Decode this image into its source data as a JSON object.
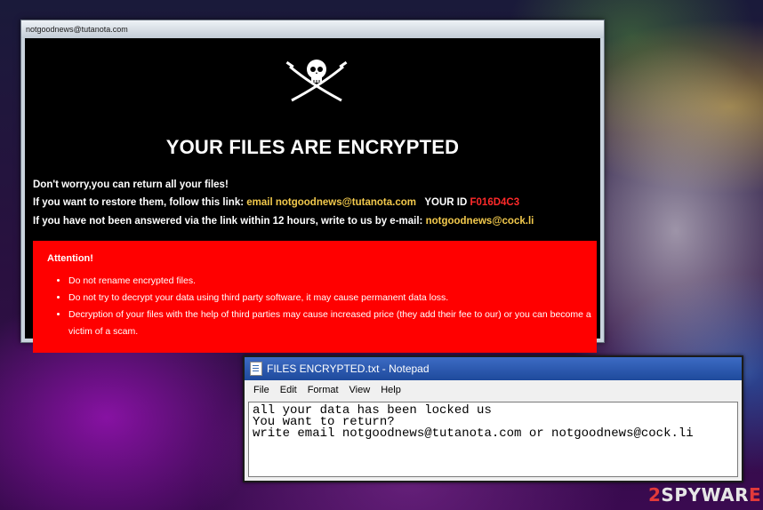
{
  "ransom_window": {
    "title": "notgoodnews@tutanota.com",
    "headline": "YOUR FILES ARE ENCRYPTED",
    "line1": "Don't worry,you can return all your files!",
    "line2_prefix": "If you want to restore them, follow this link:",
    "line2_link": "email notgoodnews@tutanota.com",
    "line2_id_label": "YOUR ID",
    "line2_id_value": "F016D4C3",
    "line3_prefix": "If you have not been answered via the link within 12 hours, write to us by e-mail:",
    "line3_email": "notgoodnews@cock.li",
    "attention": {
      "title": "Attention!",
      "items": [
        "Do not rename encrypted files.",
        "Do not try to decrypt your data using third party software, it may cause permanent data loss.",
        "Decryption of your files with the help of third parties may cause increased price (they add their fee to our) or you can become a victim of a scam."
      ]
    },
    "icon": "skull-crossbones-icon"
  },
  "notepad": {
    "title": "FILES ENCRYPTED.txt - Notepad",
    "menu": [
      "File",
      "Edit",
      "Format",
      "View",
      "Help"
    ],
    "lines": [
      "all your data has been locked us",
      "You want to return?",
      "write email notgoodnews@tutanota.com or notgoodnews@cock.li"
    ]
  },
  "watermark": {
    "part1": "2",
    "part2": "SPYWAR",
    "part3": "E"
  },
  "colors": {
    "attention_bg": "#ff0000",
    "link_yellow": "#f2c94c",
    "id_red": "#ff2a2a"
  }
}
